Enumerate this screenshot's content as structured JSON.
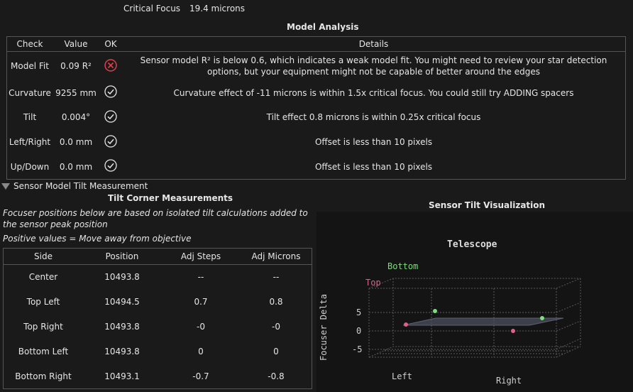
{
  "critical_focus": {
    "label": "Critical Focus",
    "value": "19.4 microns"
  },
  "model_analysis": {
    "title": "Model Analysis",
    "columns": [
      "Check",
      "Value",
      "OK",
      "Details"
    ],
    "rows": [
      {
        "check": "Model Fit",
        "value": "0.09 R²",
        "ok": "fail",
        "details": "Sensor model R² is below 0.6, which indicates a weak model fit. You might need to review your star detection options, but your equipment might not be capable of better around the edges"
      },
      {
        "check": "Curvature",
        "value": "9255 mm",
        "ok": "pass",
        "details": "Curvature effect of -11 microns is within 1.5x critical focus. You could still try ADDING spacers"
      },
      {
        "check": "Tilt",
        "value": "0.004°",
        "ok": "pass",
        "details": "Tilt effect 0.8 microns is within 0.25x critical focus"
      },
      {
        "check": "Left/Right",
        "value": "0.0 mm",
        "ok": "pass",
        "details": "Offset is less than 10 pixels"
      },
      {
        "check": "Up/Down",
        "value": "0.0 mm",
        "ok": "pass",
        "details": "Offset is less than 10 pixels"
      }
    ]
  },
  "expander": {
    "label": "Sensor Model Tilt Measurement"
  },
  "tilt_corner": {
    "title": "Tilt Corner Measurements",
    "note": "Focuser positions below are based on isolated tilt calculations added to the sensor peak position",
    "positive_note": "Positive values = Move away from objective",
    "columns": [
      "Side",
      "Position",
      "Adj Steps",
      "Adj Microns"
    ],
    "rows": [
      {
        "side": "Center",
        "position": "10493.8",
        "steps": "--",
        "microns": "--"
      },
      {
        "side": "Top Left",
        "position": "10494.5",
        "steps": "0.7",
        "microns": "0.8"
      },
      {
        "side": "Top Right",
        "position": "10493.8",
        "steps": "-0",
        "microns": "-0"
      },
      {
        "side": "Bottom Left",
        "position": "10493.8",
        "steps": "0",
        "microns": "0"
      },
      {
        "side": "Bottom Right",
        "position": "10493.1",
        "steps": "-0.7",
        "microns": "-0.8"
      }
    ]
  },
  "visualization": {
    "title": "Sensor Tilt Visualization",
    "telescope": "Telescope",
    "bottom_label": "Bottom",
    "top_label": "Top",
    "zlabel": "Focuser Delta",
    "left_label": "Left",
    "right_label": "Right",
    "z_ticks": [
      "5",
      "0",
      "-5"
    ],
    "colors": {
      "top": "#e0608a",
      "bottom": "#7fdc7f",
      "plane": "#4b4f5e"
    }
  }
}
